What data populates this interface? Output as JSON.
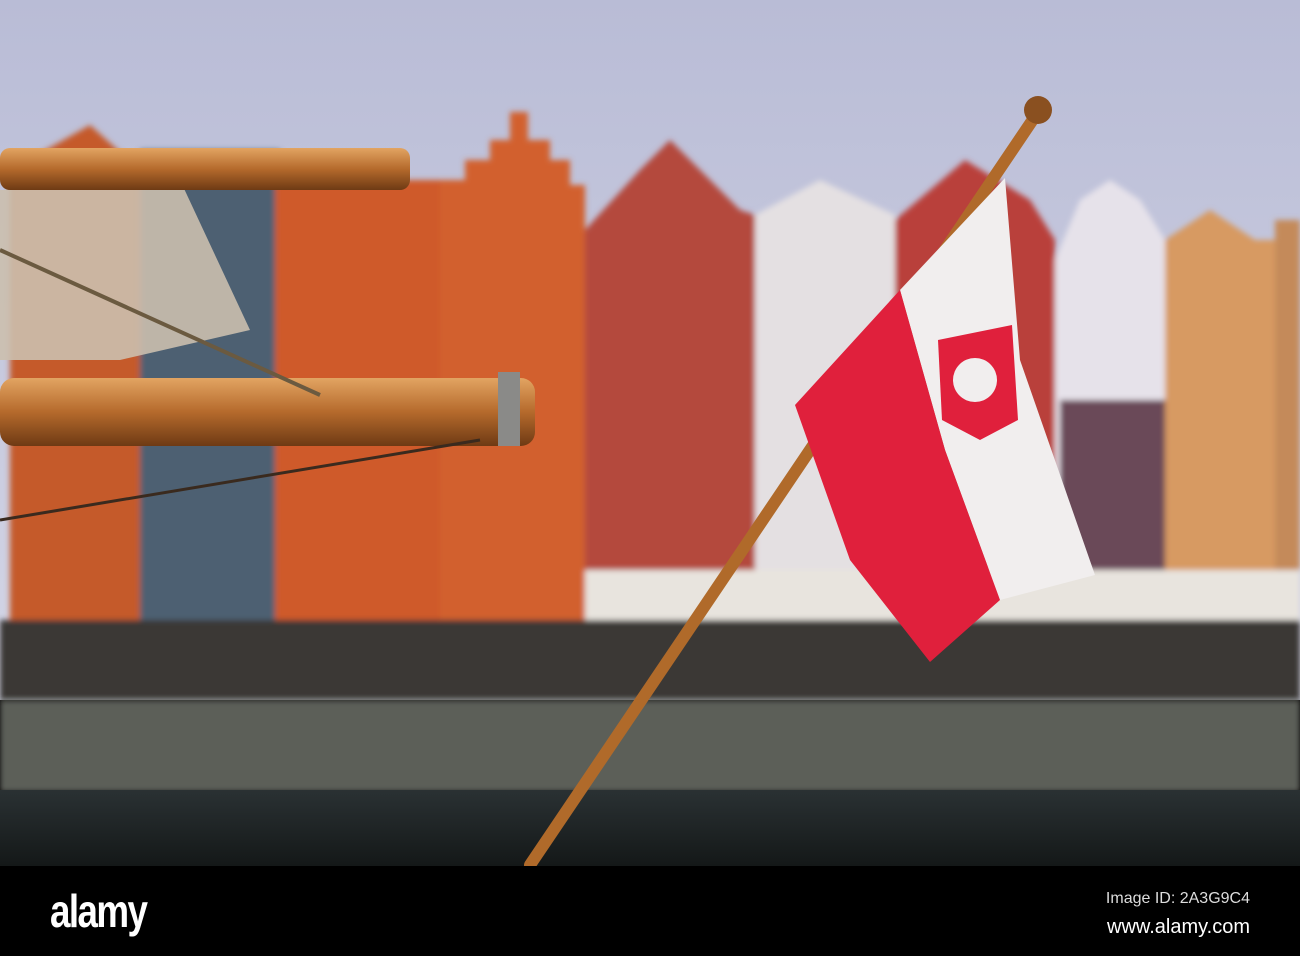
{
  "watermark": {
    "logo": "alamy",
    "image_id": "Image ID: 2A3G9C4",
    "url": "www.alamy.com"
  },
  "colors": {
    "sky": "#c9cbe0",
    "brick": "#c8542e",
    "flag_red": "#e0203c",
    "flag_white": "#f1eeee",
    "water": "#1c2224"
  }
}
